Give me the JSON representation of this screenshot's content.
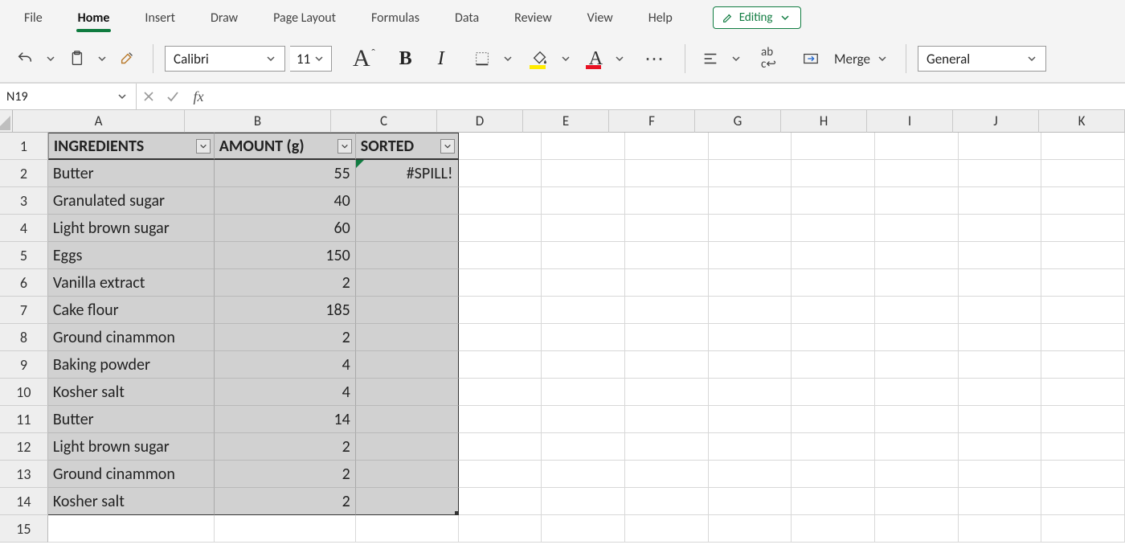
{
  "ribbon": {
    "tabs": [
      "File",
      "Home",
      "Insert",
      "Draw",
      "Page Layout",
      "Formulas",
      "Data",
      "Review",
      "View",
      "Help"
    ],
    "active_tab_index": 1,
    "mode_button": "Editing"
  },
  "toolbar": {
    "font_name": "Calibri",
    "font_size": "11",
    "merge_label": "Merge",
    "number_format": "General"
  },
  "formula_bar": {
    "name_box": "N19",
    "formula": ""
  },
  "grid": {
    "columns": [
      "A",
      "B",
      "C",
      "D",
      "E",
      "F",
      "G",
      "H",
      "I",
      "J",
      "K"
    ],
    "row_count": 15,
    "table": {
      "headers": [
        "INGREDIENTS",
        "AMOUNT (g)",
        "SORTED"
      ],
      "rows": [
        {
          "ingredient": "Butter",
          "amount": 55,
          "sorted": "#SPILL!"
        },
        {
          "ingredient": "Granulated sugar",
          "amount": 40,
          "sorted": ""
        },
        {
          "ingredient": "Light brown sugar",
          "amount": 60,
          "sorted": ""
        },
        {
          "ingredient": "Eggs",
          "amount": 150,
          "sorted": ""
        },
        {
          "ingredient": "Vanilla extract",
          "amount": 2,
          "sorted": ""
        },
        {
          "ingredient": "Cake flour",
          "amount": 185,
          "sorted": ""
        },
        {
          "ingredient": "Ground cinammon",
          "amount": 2,
          "sorted": ""
        },
        {
          "ingredient": "Baking powder",
          "amount": 4,
          "sorted": ""
        },
        {
          "ingredient": "Kosher salt",
          "amount": 4,
          "sorted": ""
        },
        {
          "ingredient": "Butter",
          "amount": 14,
          "sorted": ""
        },
        {
          "ingredient": "Light brown sugar",
          "amount": 2,
          "sorted": ""
        },
        {
          "ingredient": "Ground cinammon",
          "amount": 2,
          "sorted": ""
        },
        {
          "ingredient": "Kosher salt",
          "amount": 2,
          "sorted": ""
        }
      ]
    }
  },
  "colors": {
    "accent": "#107c41",
    "fill_highlight": "#ffeb00",
    "font_color": "#e81123"
  }
}
